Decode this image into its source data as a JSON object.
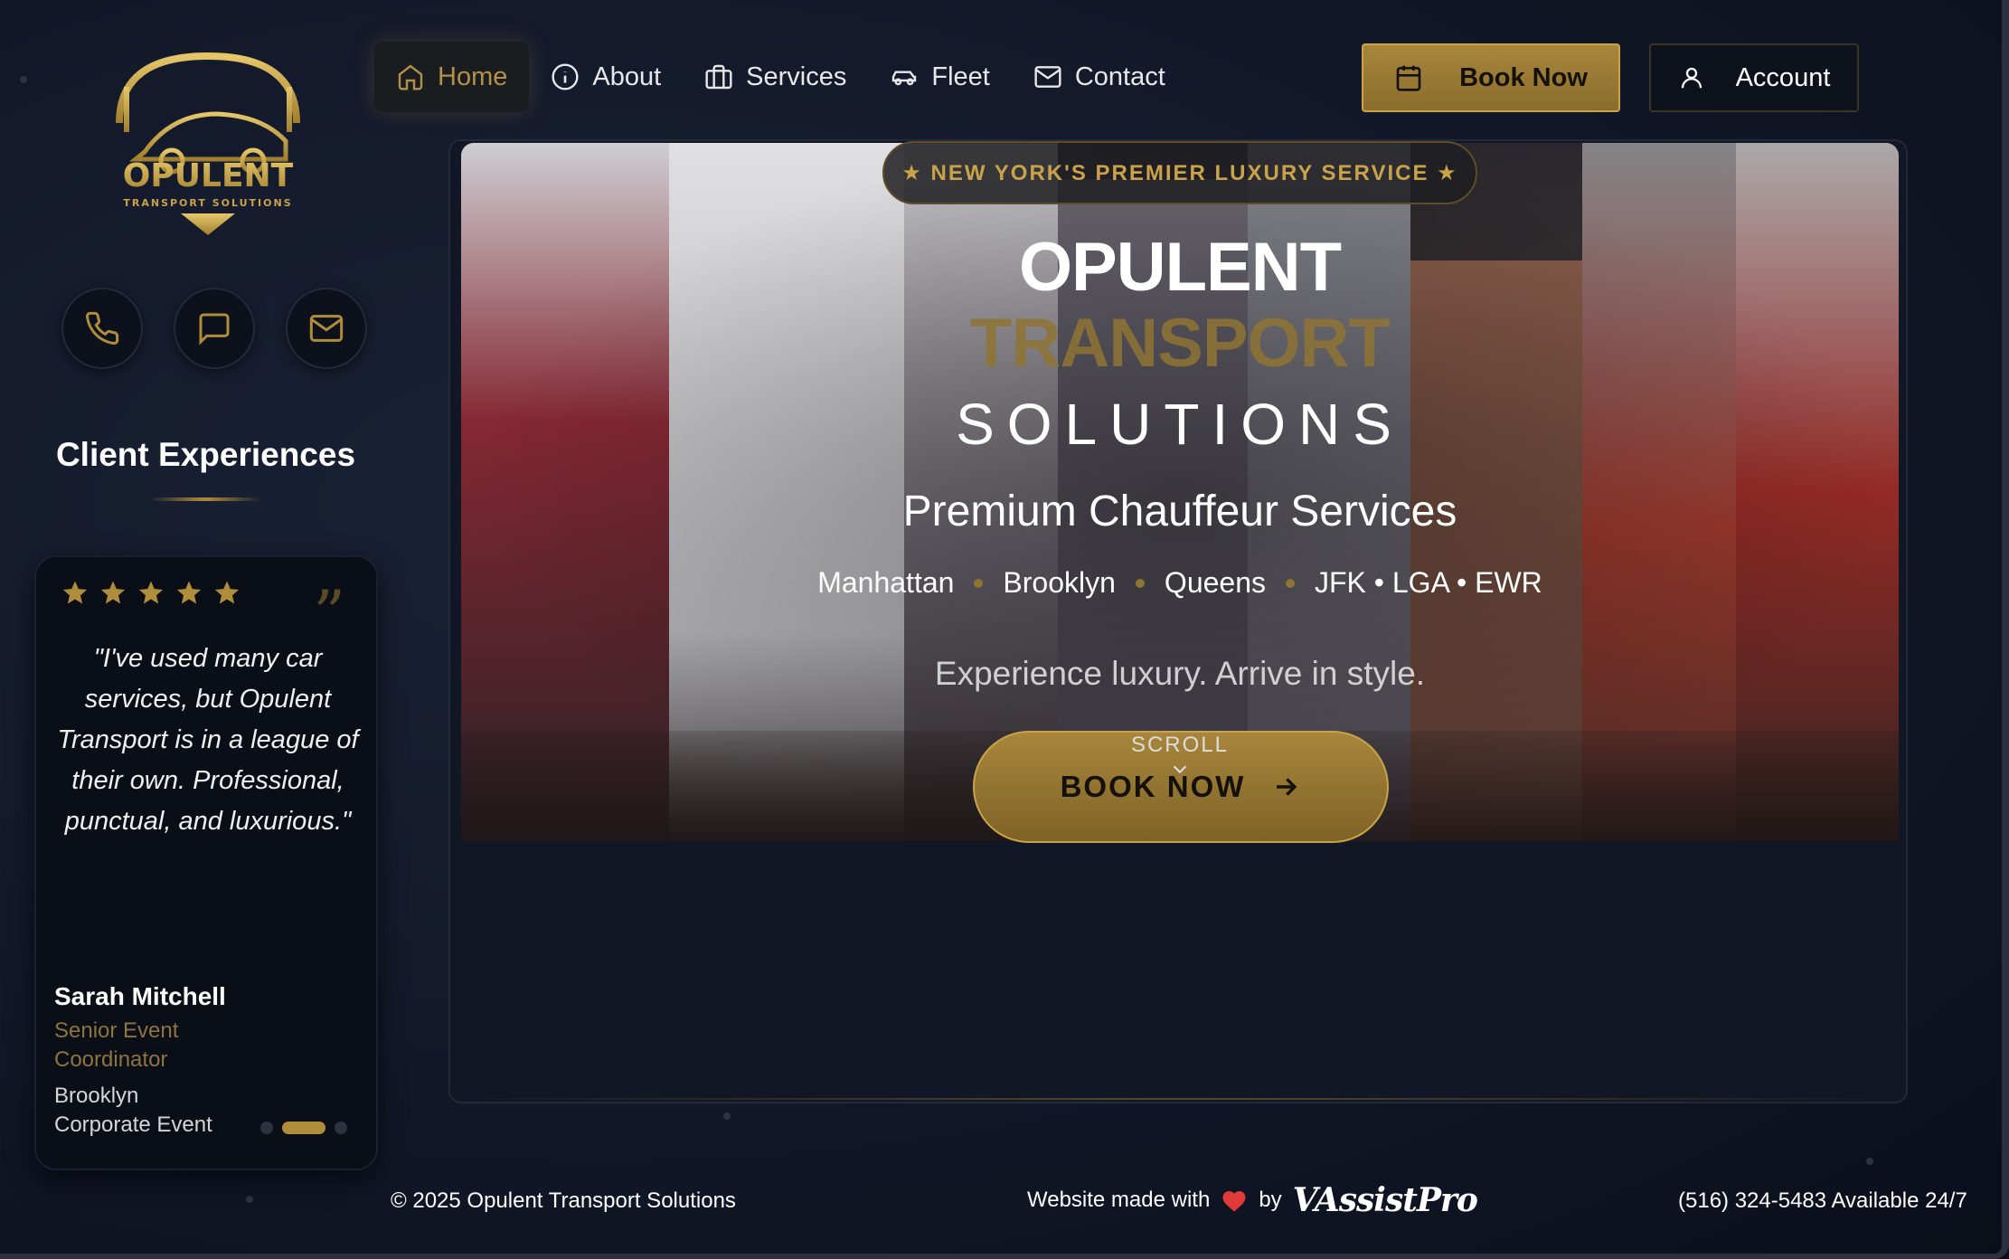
{
  "brand": {
    "logo_title": "OPULENT",
    "logo_subtitle": "TRANSPORT SOLUTIONS",
    "gold": "#b08d3a",
    "background": "#121828"
  },
  "sidebar": {
    "contact_icons": [
      "phone-icon",
      "message-icon",
      "mail-icon"
    ],
    "testimonials": {
      "heading": "Client Experiences",
      "rating": 5,
      "quote": "\"I've used many car services, but Opulent Transport is in a league of their own. Professional, punctual, and luxurious.\"",
      "name": "Sarah Mitchell",
      "role": "Senior Event Coordinator",
      "context": "Brooklyn Corporate Event",
      "active_slide": 2,
      "slide_count": 3
    }
  },
  "nav": {
    "items": [
      {
        "label": "Home",
        "icon": "home-icon",
        "active": true
      },
      {
        "label": "About",
        "icon": "info-icon"
      },
      {
        "label": "Services",
        "icon": "briefcase-icon"
      },
      {
        "label": "Fleet",
        "icon": "car-icon"
      },
      {
        "label": "Contact",
        "icon": "mail-icon"
      }
    ],
    "book_label": "Book Now",
    "account_label": "Account"
  },
  "hero": {
    "badge": "★ NEW YORK'S PREMIER LUXURY SERVICE ★",
    "title_line1": "OPULENT",
    "title_line2": "TRANSPORT",
    "title_line3": "SOLUTIONS",
    "tagline": "Premium Chauffeur Services",
    "areas": [
      "Manhattan",
      "Brooklyn",
      "Queens",
      "JFK • LGA • EWR"
    ],
    "subtext": "Experience luxury. Arrive in style.",
    "cta_label": "BOOK NOW",
    "scroll_label": "SCROLL"
  },
  "footer": {
    "copyright": "© 2025 Opulent Transport Solutions",
    "made_with": "Website made with",
    "by": "by",
    "maker": "VAssistPro",
    "phone": "(516) 324-5483 Available 24/7"
  }
}
